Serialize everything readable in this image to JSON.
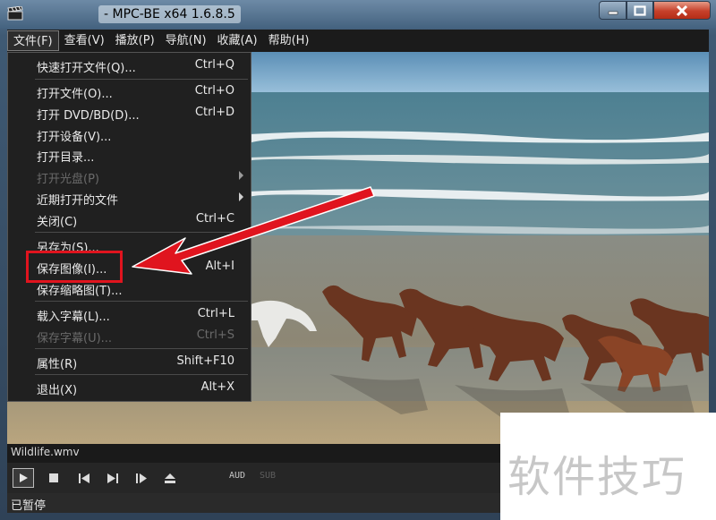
{
  "window": {
    "title": "- MPC-BE x64 1.6.8.5"
  },
  "menubar": {
    "items": [
      {
        "label": "文件(F)"
      },
      {
        "label": "查看(V)"
      },
      {
        "label": "播放(P)"
      },
      {
        "label": "导航(N)"
      },
      {
        "label": "收藏(A)"
      },
      {
        "label": "帮助(H)"
      }
    ]
  },
  "file_menu": {
    "items": [
      {
        "label": "快速打开文件(Q)...",
        "shortcut": "Ctrl+Q"
      },
      {
        "label": "打开文件(O)...",
        "shortcut": "Ctrl+O"
      },
      {
        "label": "打开 DVD/BD(D)...",
        "shortcut": "Ctrl+D"
      },
      {
        "label": "打开设备(V)...",
        "shortcut": ""
      },
      {
        "label": "打开目录...",
        "shortcut": ""
      },
      {
        "label": "打开光盘(P)",
        "shortcut": "",
        "disabled": true,
        "submenu": true
      },
      {
        "label": "近期打开的文件",
        "shortcut": "",
        "submenu": true
      },
      {
        "label": "关闭(C)",
        "shortcut": "Ctrl+C"
      },
      {
        "label": "另存为(S)...",
        "shortcut": ""
      },
      {
        "label": "保存图像(I)...",
        "shortcut": "Alt+I"
      },
      {
        "label": "保存缩略图(T)...",
        "shortcut": ""
      },
      {
        "label": "载入字幕(L)...",
        "shortcut": "Ctrl+L"
      },
      {
        "label": "保存字幕(U)...",
        "shortcut": "Ctrl+S",
        "disabled": true
      },
      {
        "label": "属性(R)",
        "shortcut": "Shift+F10"
      },
      {
        "label": "退出(X)",
        "shortcut": "Alt+X"
      }
    ]
  },
  "player": {
    "file_name": "Wildlife.wmv",
    "audio_label": "AUD",
    "subtitle_label": "SUB",
    "status": "已暂停"
  },
  "watermark": {
    "text": "软件技巧"
  },
  "colors": {
    "annotation_red": "#e0141e",
    "menu_bg": "#202020"
  }
}
